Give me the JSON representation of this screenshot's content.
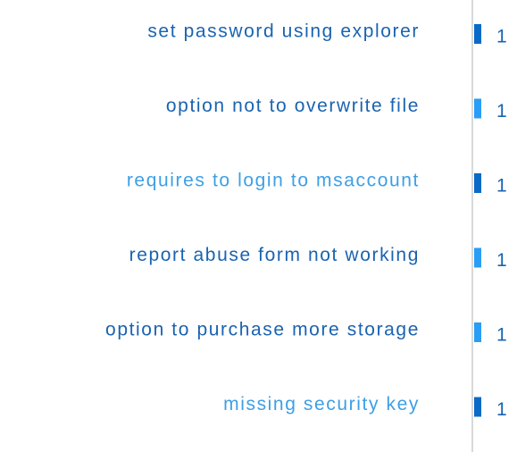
{
  "chart_data": {
    "type": "bar",
    "orientation": "horizontal",
    "categories": [
      "set password using explorer",
      "option not to overwrite file",
      "requires to login to msaccount",
      "report abuse form not working",
      "option to purchase more storage",
      "missing security key"
    ],
    "values": [
      1,
      1,
      1,
      1,
      1,
      1
    ],
    "bar_colors": [
      "#0a6ac8",
      "#2a9df4",
      "#0a6ac8",
      "#2a9df4",
      "#2a9df4",
      "#0a6ac8"
    ],
    "label_colors": [
      "#1a63b0",
      "#1a63b0",
      "#3d9fe6",
      "#1a63b0",
      "#1a63b0",
      "#3d9fe6"
    ],
    "value_color": "#1a63b0",
    "axis_color": "#cccccc",
    "xlim": [
      0,
      1
    ],
    "grid": false,
    "legend": "none"
  }
}
